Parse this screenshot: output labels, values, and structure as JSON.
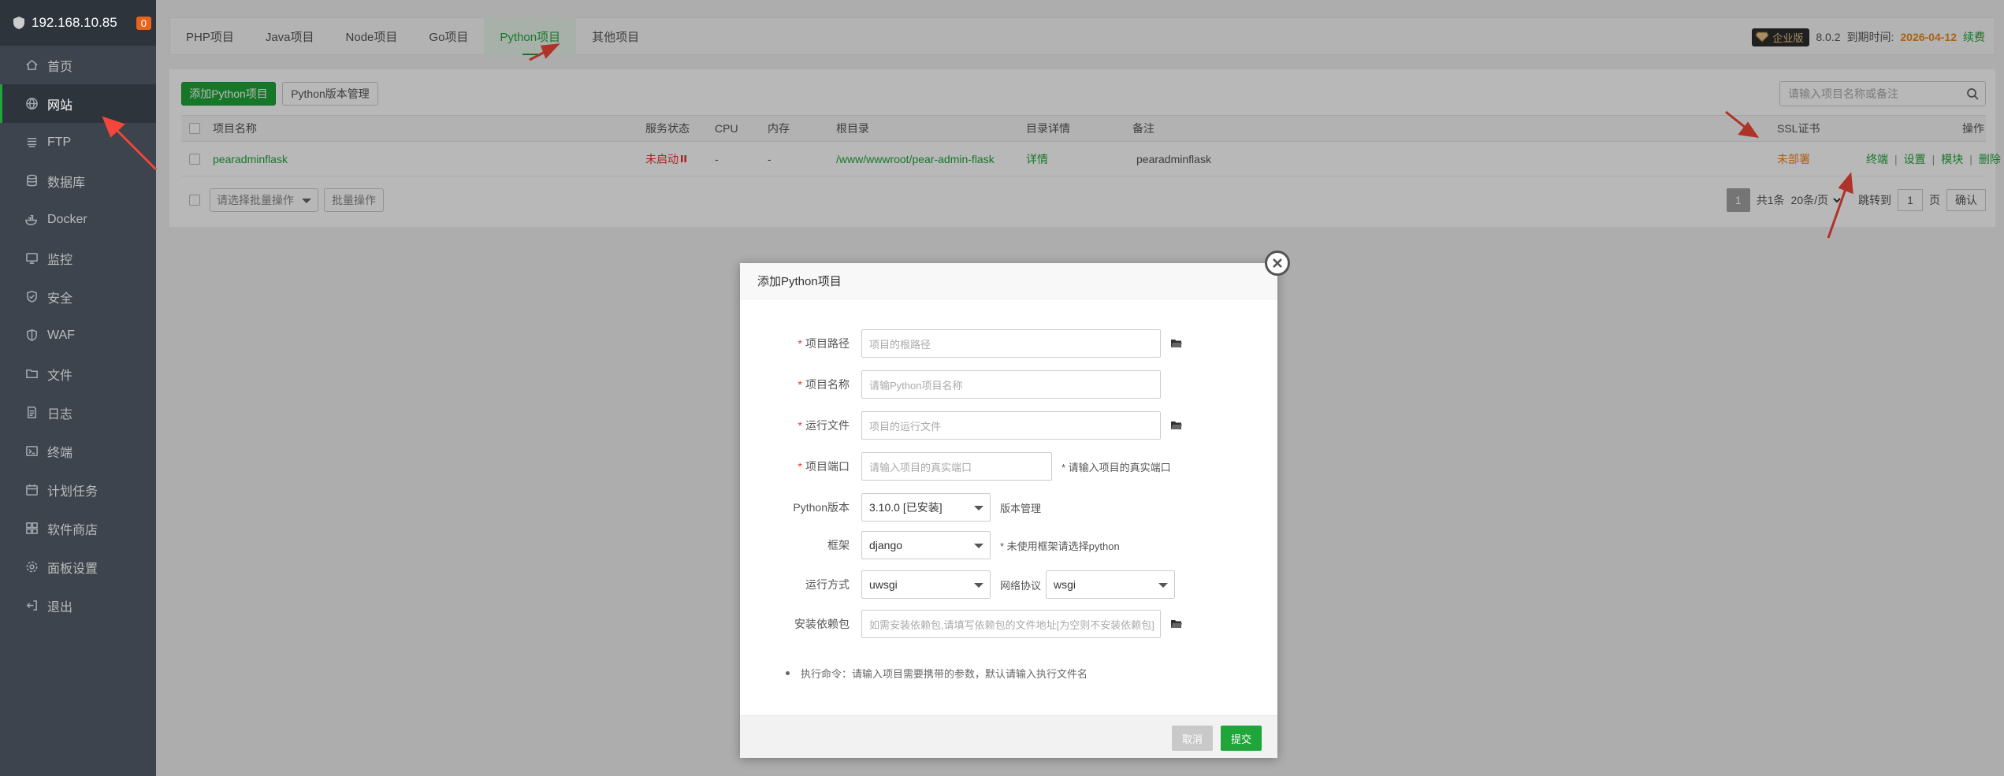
{
  "sidebar": {
    "ip": "192.168.10.85",
    "badge": "0",
    "items": [
      {
        "label": "首页",
        "icon": "home-icon"
      },
      {
        "label": "网站",
        "icon": "globe-icon"
      },
      {
        "label": "FTP",
        "icon": "ftp-icon"
      },
      {
        "label": "数据库",
        "icon": "database-icon"
      },
      {
        "label": "Docker",
        "icon": "docker-icon"
      },
      {
        "label": "监控",
        "icon": "monitor-icon"
      },
      {
        "label": "安全",
        "icon": "shield-icon"
      },
      {
        "label": "WAF",
        "icon": "waf-icon"
      },
      {
        "label": "文件",
        "icon": "folder-icon"
      },
      {
        "label": "日志",
        "icon": "log-icon"
      },
      {
        "label": "终端",
        "icon": "terminal-icon"
      },
      {
        "label": "计划任务",
        "icon": "calendar-icon"
      },
      {
        "label": "软件商店",
        "icon": "apps-icon"
      },
      {
        "label": "面板设置",
        "icon": "gear-icon"
      },
      {
        "label": "退出",
        "icon": "logout-icon"
      }
    ],
    "active_index": 1
  },
  "tabs": [
    "PHP项目",
    "Java项目",
    "Node项目",
    "Go项目",
    "Python项目",
    "其他项目"
  ],
  "active_tab": "Python项目",
  "version": {
    "edition": "企业版",
    "number": "8.0.2",
    "expire_label": "到期时间:",
    "expire_date": "2026-04-12",
    "renew": "续费"
  },
  "toolbar": {
    "add_button": "添加Python项目",
    "version_button": "Python版本管理",
    "search_placeholder": "请输入项目名称或备注"
  },
  "table": {
    "headers": {
      "name": "项目名称",
      "status": "服务状态",
      "cpu": "CPU",
      "mem": "内存",
      "root": "根目录",
      "detail": "目录详情",
      "remark": "备注",
      "ssl": "SSL证书",
      "actions": "操作"
    },
    "rows": [
      {
        "name": "pearadminflask",
        "status": "未启动",
        "cpu": "-",
        "mem": "-",
        "root": "/www/wwwroot/pear-admin-flask",
        "detail": "详情",
        "remark": "pearadminflask",
        "ssl": "未部署",
        "actions": [
          "终端",
          "设置",
          "模块",
          "删除"
        ]
      }
    ]
  },
  "footer": {
    "batch_select": "请选择批量操作",
    "batch_button": "批量操作",
    "page": "1",
    "total": "共1条",
    "per_page": "20条/页",
    "goto_label": "跳转到",
    "goto_value": "1",
    "page_unit": "页",
    "confirm": "确认"
  },
  "modal": {
    "title": "添加Python项目",
    "fields": {
      "path_label": "项目路径",
      "path_placeholder": "项目的根路径",
      "name_label": "项目名称",
      "name_placeholder": "请输Python项目名称",
      "run_file_label": "运行文件",
      "run_file_placeholder": "项目的运行文件",
      "port_label": "项目端口",
      "port_placeholder": "请输入项目的真实端口",
      "port_hint": "* 请输入项目的真实端口",
      "py_version_label": "Python版本",
      "py_version_value": "3.10.0 [已安装]",
      "version_manage_link": "版本管理",
      "framework_label": "框架",
      "framework_value": "django",
      "framework_hint": "* 未使用框架请选择python",
      "run_mode_label": "运行方式",
      "run_mode_value": "uwsgi",
      "protocol_label": "网络协议",
      "protocol_value": "wsgi",
      "deps_label": "安装依赖包",
      "deps_placeholder": "如需安装依赖包,请填写依赖包的文件地址[为空则不安装依赖包]"
    },
    "note": "执行命令：请输入项目需要携带的参数，默认请输入执行文件名",
    "cancel": "取消",
    "submit": "提交"
  },
  "colors": {
    "accent": "#20a53a",
    "sidebar": "#3d444d",
    "warning": "#f0861c",
    "danger": "#ee3333",
    "arrow": "#f2473a"
  }
}
